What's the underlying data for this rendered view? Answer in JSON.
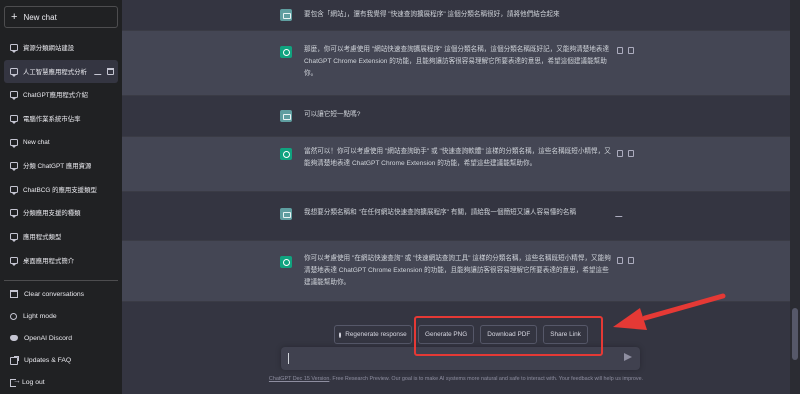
{
  "sidebar": {
    "new_chat": "New chat",
    "items": [
      {
        "label": "資源分類網站建設"
      },
      {
        "label": "人工智慧應用程式分析"
      },
      {
        "label": "ChatGPT應用程式介紹"
      },
      {
        "label": "電腦作業系統市佔率"
      },
      {
        "label": "New chat"
      },
      {
        "label": "分類 ChatGPT 應用資源"
      },
      {
        "label": "ChatBCG 的應用支援類型"
      },
      {
        "label": "分類應用支援的種類"
      },
      {
        "label": "應用程式類型"
      },
      {
        "label": "桌面應用程式簡介"
      }
    ],
    "bottom": [
      {
        "label": "Clear conversations",
        "icon": "trash-icon"
      },
      {
        "label": "Light mode",
        "icon": "sun-icon"
      },
      {
        "label": "OpenAI Discord",
        "icon": "discord-icon"
      },
      {
        "label": "Updates & FAQ",
        "icon": "external-link-icon"
      },
      {
        "label": "Log out",
        "icon": "logout-icon"
      }
    ]
  },
  "conversation": [
    {
      "role": "user",
      "text": "要包含「網站」，還有我覺得 \"快速查詢擴展程序\" 這個分類名稱很好，請將他們結合起來"
    },
    {
      "role": "assistant",
      "text": "那麼，你可以考慮使用 \"網站快速查詢擴展程序\" 這個分類名稱，這個分類名稱既好記，又能夠清楚地表達 ChatGPT Chrome Extension 的功能，且能夠讓訪客很容易理解它所要表達的意思，希望這個建議能幫助你。"
    },
    {
      "role": "user",
      "text": "可以讓它短一點嗎?"
    },
    {
      "role": "assistant",
      "text": "當然可以！你可以考慮使用 \"網站查詢助手\" 或 \"快速查詢軟體\" 這樣的分類名稱，這些名稱既短小精悍，又能夠清楚地表達 ChatGPT Chrome Extension 的功能，希望這些建議能幫助你。"
    },
    {
      "role": "user",
      "text": "我想要分類名稱和 \"在任何網站快速查詢擴展程序\" 有關，請給我一個簡短又讓人容易懂的名稱"
    },
    {
      "role": "assistant",
      "text": "你可以考慮使用 \"在網站快速查詢\" 或 \"快速網站查詢工具\" 這樣的分類名稱，這些名稱既短小精悍，又能夠清楚地表達 ChatGPT Chrome Extension 的功能，且能夠讓訪客很容易理解它所要表達的意思，希望這些建議能幫助你。"
    }
  ],
  "actions": {
    "regenerate": "Regenerate response",
    "generate_png": "Generate PNG",
    "download_pdf": "Download PDF",
    "share_link": "Share Link"
  },
  "input": {
    "value": ""
  },
  "footer": {
    "link": "ChatGPT Dec 15 Version",
    "text": ". Free Research Preview. Our goal is to make AI systems more natural and safe to interact with. Your feedback will help us improve."
  },
  "colors": {
    "accent": "#10a37f",
    "highlight": "#e53935",
    "sidebar_bg": "#202123",
    "main_bg": "#343541"
  }
}
